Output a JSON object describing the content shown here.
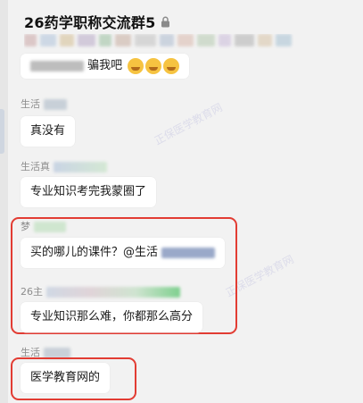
{
  "header": {
    "title": "26药学职称交流群5",
    "lock_icon": "lock-icon"
  },
  "messages": [
    {
      "sender": "",
      "text": "骗我吧"
    },
    {
      "sender": "生活",
      "text": "真没有"
    },
    {
      "sender": "生活真",
      "text": "专业知识考完我蒙圈了"
    },
    {
      "sender": "梦",
      "text": "买的哪儿的课件？@生活"
    },
    {
      "sender": "26主",
      "text": "专业知识那么难，你都那么高分"
    },
    {
      "sender": "生活",
      "text": "医学教育网的"
    }
  ],
  "watermark": "正保医学教育网",
  "colors": {
    "highlight": "#e23c33",
    "bubble": "#ffffff",
    "background": "#f2f2f2"
  }
}
